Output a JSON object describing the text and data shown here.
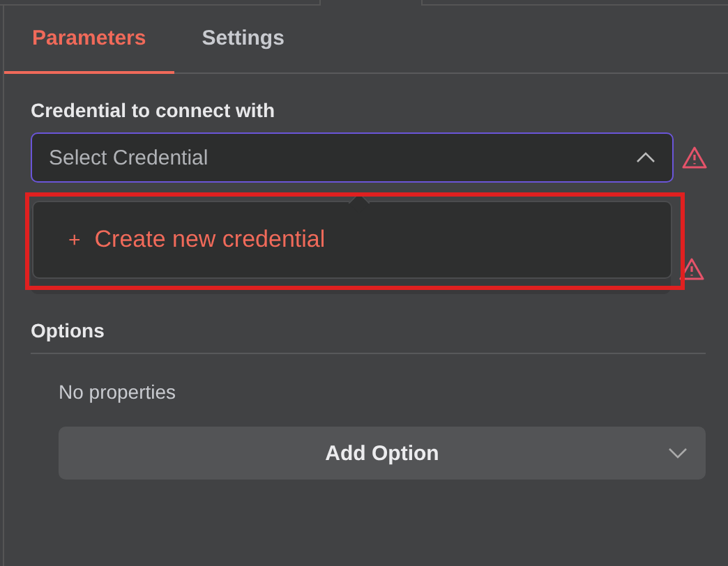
{
  "tabs": [
    {
      "label": "Parameters",
      "selected": true
    },
    {
      "label": "Settings",
      "selected": false
    }
  ],
  "credential": {
    "label": "Credential to connect with",
    "placeholder": "Select Credential",
    "expanded": true,
    "warning": true
  },
  "dropdown": {
    "items": [
      {
        "icon": "+",
        "label": "Create new credential"
      }
    ],
    "highlighted": true
  },
  "second_field": {
    "warning": true
  },
  "options": {
    "heading": "Options",
    "empty_text": "No properties",
    "button": "Add Option"
  }
}
